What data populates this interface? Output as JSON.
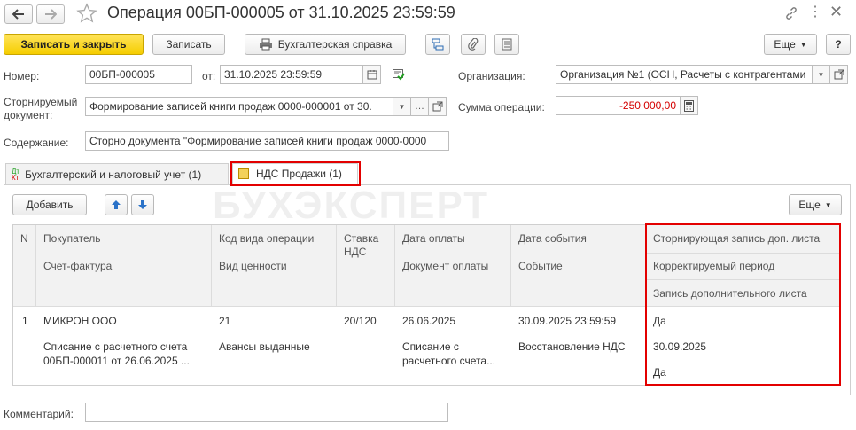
{
  "window": {
    "title": "Операция 00БП-000005 от 31.10.2025 23:59:59"
  },
  "toolbar": {
    "save_close": "Записать и закрыть",
    "save": "Записать",
    "report": "Бухгалтерская справка",
    "more": "Еще",
    "help": "?"
  },
  "form": {
    "number_label": "Номер:",
    "number_value": "00БП-000005",
    "date_label": "от:",
    "date_value": "31.10.2025 23:59:59",
    "org_label": "Организация:",
    "org_value": "Организация №1 (ОСН, Расчеты с контрагентами",
    "storno_label_1": "Сторнируемый",
    "storno_label_2": "документ:",
    "storno_value": "Формирование записей книги продаж 0000-000001 от 30.",
    "sum_label": "Сумма операции:",
    "sum_value": "-250 000,00",
    "content_label": "Содержание:",
    "content_value": "Сторно документа \"Формирование записей книги продаж 0000-0000",
    "comment_label": "Комментарий:",
    "comment_value": ""
  },
  "tabs": [
    {
      "label": "Бухгалтерский и налоговый учет (1)",
      "icon": "dt-kt-icon"
    },
    {
      "label": "НДС Продажи (1)",
      "icon": "vat-doc-icon"
    }
  ],
  "table_toolbar": {
    "add": "Добавить",
    "more": "Еще"
  },
  "watermark": "БУХЭКСПЕРТ",
  "table": {
    "headers": {
      "n": "N",
      "buyer": "Покупатель",
      "invoice": "Счет-фактура",
      "op_code": "Код вида операции",
      "value_type": "Вид ценности",
      "vat_rate": "Ставка НДС",
      "pay_date": "Дата оплаты",
      "pay_doc": "Документ оплаты",
      "event_date": "Дата события",
      "event": "Событие",
      "storno_extra": "Сторнирующая запись доп. листа",
      "corr_period": "Корректируемый период",
      "extra_sheet": "Запись дополнительного листа"
    },
    "row": {
      "n": "1",
      "buyer": "МИКРОН ООО",
      "invoice_1": "Списание с расчетного счета",
      "invoice_2": "00БП-000011 от 26.06.2025 ...",
      "op_code": "21",
      "value_type": "Авансы выданные",
      "vat_rate": "20/120",
      "pay_date": "26.06.2025",
      "pay_doc_1": "Списание с",
      "pay_doc_2": "расчетного счета...",
      "event_date": "30.09.2025 23:59:59",
      "event": "Восстановление НДС",
      "storno_extra": "Да",
      "corr_period": "30.09.2025",
      "extra_sheet": "Да"
    }
  },
  "colors": {
    "accent": "#f5cd00",
    "highlight": "#e30000",
    "negative": "#d40000"
  }
}
